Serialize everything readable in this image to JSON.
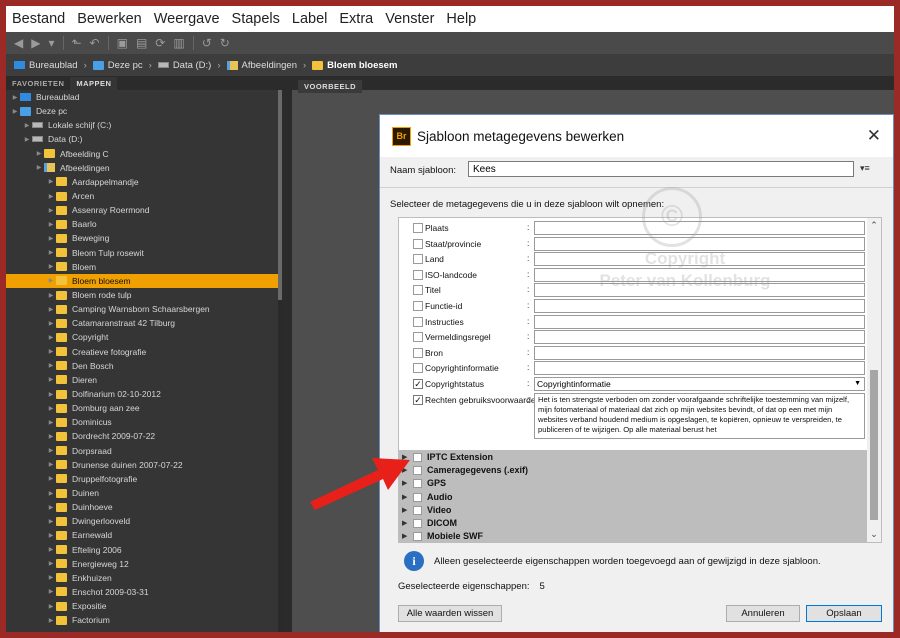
{
  "menu": [
    "Bestand",
    "Bewerken",
    "Weergave",
    "Stapels",
    "Label",
    "Extra",
    "Venster",
    "Help"
  ],
  "breadcrumb": [
    "Bureaublad",
    "Deze pc",
    "Data (D:)",
    "Afbeeldingen",
    "Bloem bloesem"
  ],
  "left_panel": {
    "tabs": [
      "FAVORIETEN",
      "MAPPEN"
    ],
    "tree": [
      {
        "label": "Bureaublad",
        "indent": 0,
        "icon": "desktop"
      },
      {
        "label": "Deze pc",
        "indent": 0,
        "icon": "pc"
      },
      {
        "label": "Lokale schijf (C:)",
        "indent": 1,
        "icon": "drive"
      },
      {
        "label": "Data (D:)",
        "indent": 1,
        "icon": "drive"
      },
      {
        "label": "Afbeelding C",
        "indent": 2,
        "icon": "folder"
      },
      {
        "label": "Afbeeldingen",
        "indent": 2,
        "icon": "imgfolder"
      },
      {
        "label": "Aardappelmandje",
        "indent": 3,
        "icon": "folder"
      },
      {
        "label": "Arcen",
        "indent": 3,
        "icon": "folder"
      },
      {
        "label": "Assenray Roermond",
        "indent": 3,
        "icon": "folder"
      },
      {
        "label": "Baarlo",
        "indent": 3,
        "icon": "folder"
      },
      {
        "label": "Beweging",
        "indent": 3,
        "icon": "folder"
      },
      {
        "label": "Bleom Tulp rosewit",
        "indent": 3,
        "icon": "folder"
      },
      {
        "label": "Bloem",
        "indent": 3,
        "icon": "folder"
      },
      {
        "label": "Bloem bloesem",
        "indent": 3,
        "icon": "folder",
        "selected": true
      },
      {
        "label": "Bloem rode tulp",
        "indent": 3,
        "icon": "folder"
      },
      {
        "label": "Camping Warnsborn Schaarsbergen",
        "indent": 3,
        "icon": "folder"
      },
      {
        "label": "Catamaranstraat 42 Tilburg",
        "indent": 3,
        "icon": "folder"
      },
      {
        "label": "Copyright",
        "indent": 3,
        "icon": "folder"
      },
      {
        "label": "Creatieve fotografie",
        "indent": 3,
        "icon": "folder"
      },
      {
        "label": "Den Bosch",
        "indent": 3,
        "icon": "folder"
      },
      {
        "label": "Dieren",
        "indent": 3,
        "icon": "folder"
      },
      {
        "label": "Dolfinarium 02-10-2012",
        "indent": 3,
        "icon": "folder"
      },
      {
        "label": "Domburg aan zee",
        "indent": 3,
        "icon": "folder"
      },
      {
        "label": "Dominicus",
        "indent": 3,
        "icon": "folder"
      },
      {
        "label": "Dordrecht 2009-07-22",
        "indent": 3,
        "icon": "folder"
      },
      {
        "label": "Dorpsraad",
        "indent": 3,
        "icon": "folder"
      },
      {
        "label": "Drunense duinen 2007-07-22",
        "indent": 3,
        "icon": "folder"
      },
      {
        "label": "Druppelfotografie",
        "indent": 3,
        "icon": "folder"
      },
      {
        "label": "Duinen",
        "indent": 3,
        "icon": "folder"
      },
      {
        "label": "Duinhoeve",
        "indent": 3,
        "icon": "folder"
      },
      {
        "label": "Dwingerlooveld",
        "indent": 3,
        "icon": "folder"
      },
      {
        "label": "Earnewald",
        "indent": 3,
        "icon": "folder"
      },
      {
        "label": "Efteling 2006",
        "indent": 3,
        "icon": "folder"
      },
      {
        "label": "Energieweg 12",
        "indent": 3,
        "icon": "folder"
      },
      {
        "label": "Enkhuizen",
        "indent": 3,
        "icon": "folder"
      },
      {
        "label": "Enschot 2009-03-31",
        "indent": 3,
        "icon": "folder"
      },
      {
        "label": "Expositie",
        "indent": 3,
        "icon": "folder"
      },
      {
        "label": "Factorium",
        "indent": 3,
        "icon": "folder"
      }
    ]
  },
  "right_panel": {
    "tab": "VOORBEELD"
  },
  "dialog": {
    "title": "Sjabloon metagegevens bewerken",
    "close": "✕",
    "name_label": "Naam sjabloon:",
    "name_value": "Kees",
    "instruction": "Selecteer de metagegevens die u in deze sjabloon wilt opnemen:",
    "watermark": {
      "symbol": "©",
      "line1": "Copyright",
      "line2": "Peter van Kollenburg"
    },
    "fields": [
      {
        "label": "Plaats",
        "checked": false,
        "type": "input",
        "value": ""
      },
      {
        "label": "Staat/provincie",
        "checked": false,
        "type": "input",
        "value": ""
      },
      {
        "label": "Land",
        "checked": false,
        "type": "input",
        "value": ""
      },
      {
        "label": "ISO-landcode",
        "checked": false,
        "type": "input",
        "value": ""
      },
      {
        "label": "Titel",
        "checked": false,
        "type": "input",
        "value": ""
      },
      {
        "label": "Functie-id",
        "checked": false,
        "type": "input",
        "value": ""
      },
      {
        "label": "Instructies",
        "checked": false,
        "type": "input",
        "value": ""
      },
      {
        "label": "Vermeldingsregel",
        "checked": false,
        "type": "input",
        "value": ""
      },
      {
        "label": "Bron",
        "checked": false,
        "type": "input",
        "value": ""
      },
      {
        "label": "Copyrightinformatie",
        "checked": false,
        "type": "input",
        "value": ""
      },
      {
        "label": "Copyrightstatus",
        "checked": true,
        "type": "select",
        "value": "Copyrightinformatie"
      },
      {
        "label": "Rechten gebruiksvoorwaarden",
        "checked": true,
        "type": "textarea",
        "value": "Het is ten strengste verboden om zonder voorafgaande schriftelijke toestemming van mijzelf, mijn fotomateriaal of materiaal dat zich op mijn websites bevindt, of dat op een met mijn websites verband houdend medium is opgeslagen, te kopiëren, opnieuw te verspreiden, te publiceren of te wijzigen. Op alle materiaal berust het"
      }
    ],
    "groups": [
      "IPTC Extension",
      "Cameragegevens (.exif)",
      "GPS",
      "Audio",
      "Video",
      "DICOM",
      "Mobiele SWF"
    ],
    "info_text": "Alleen geselecteerde eigenschappen worden toegevoegd aan of gewijzigd in deze sjabloon.",
    "selected_label": "Geselecteerde eigenschappen:",
    "selected_count": "5",
    "buttons": {
      "clear": "Alle waarden wissen",
      "cancel": "Annuleren",
      "save": "Opslaan"
    }
  },
  "colors": {
    "frame": "#9b2a26",
    "selection": "#f0a000",
    "arrow": "#e8201a",
    "dialog_border": "#6d8fbf"
  }
}
